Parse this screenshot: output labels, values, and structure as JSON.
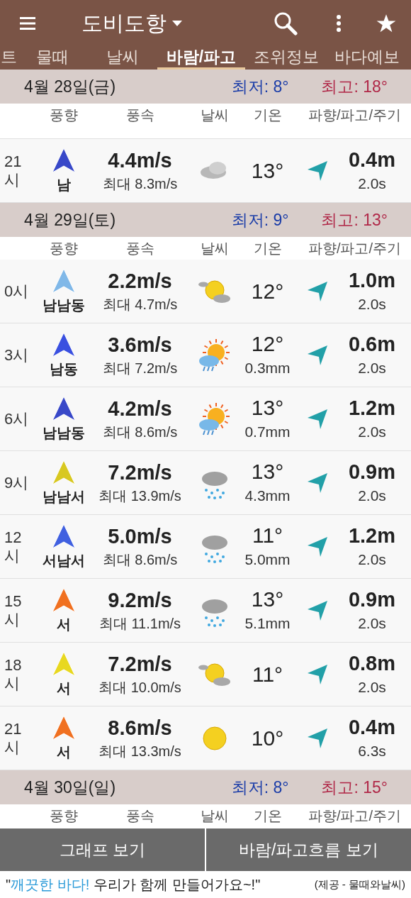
{
  "app_bar": {
    "title": "도비도항"
  },
  "tabs": [
    {
      "label": "트",
      "selected": false
    },
    {
      "label": "물때",
      "selected": false
    },
    {
      "label": "날씨",
      "selected": false
    },
    {
      "label": "바람/파고",
      "selected": true
    },
    {
      "label": "조위정보",
      "selected": false
    },
    {
      "label": "바다예보",
      "selected": false
    }
  ],
  "days": [
    {
      "date": "4월 28일(금)",
      "low": "최저: 8°",
      "high": "최고: 18°",
      "columns": [
        "풍향",
        "풍속",
        "날씨",
        "기온",
        "파향/파고/주기"
      ],
      "rows": [
        {
          "time": "21시",
          "direction": "남",
          "color": "#3848c8",
          "speed": "4.4m/s",
          "max": "최대 8.3m/s",
          "kind": "cloudy",
          "temp": "13°",
          "wave": "0.4m",
          "period": "2.0s"
        }
      ]
    },
    {
      "date": "4월 29일(토)",
      "low": "최저: 9°",
      "high": "최고: 13°",
      "columns": [
        "풍향",
        "풍속",
        "날씨",
        "기온",
        "파향/파고/주기"
      ],
      "rows": [
        {
          "time": "0시",
          "direction": "남남동",
          "color": "#80b8e8",
          "speed": "2.2m/s",
          "max": "최대 4.7m/s",
          "kind": "sun_cloud",
          "temp": "12°",
          "wave": "1.0m",
          "period": "2.0s"
        },
        {
          "time": "3시",
          "direction": "남동",
          "color": "#3a50e0",
          "speed": "3.6m/s",
          "max": "최대 7.2m/s",
          "kind": "sun_rain",
          "temp": "12°",
          "rain": "0.3mm",
          "wave": "0.6m",
          "period": "2.0s"
        },
        {
          "time": "6시",
          "direction": "남남동",
          "color": "#3848c8",
          "speed": "4.2m/s",
          "max": "최대 8.6m/s",
          "kind": "sun_rain",
          "temp": "13°",
          "rain": "0.7mm",
          "wave": "1.2m",
          "period": "2.0s"
        },
        {
          "time": "9시",
          "direction": "남남서",
          "color": "#d8c820",
          "speed": "7.2m/s",
          "max": "최대 13.9m/s",
          "kind": "rain",
          "temp": "13°",
          "rain": "4.3mm",
          "wave": "0.9m",
          "period": "2.0s"
        },
        {
          "time": "12시",
          "direction": "서남서",
          "color": "#4060e0",
          "speed": "5.0m/s",
          "max": "최대 8.6m/s",
          "kind": "rain",
          "temp": "11°",
          "rain": "5.0mm",
          "wave": "1.2m",
          "period": "2.0s"
        },
        {
          "time": "15시",
          "direction": "서",
          "color": "#f07020",
          "speed": "9.2m/s",
          "max": "최대 11.1m/s",
          "kind": "rain",
          "temp": "13°",
          "rain": "5.1mm",
          "wave": "0.9m",
          "period": "2.0s"
        },
        {
          "time": "18시",
          "direction": "서",
          "color": "#e8d820",
          "speed": "7.2m/s",
          "max": "최대 10.0m/s",
          "kind": "sun_cloud",
          "temp": "11°",
          "wave": "0.8m",
          "period": "2.0s"
        },
        {
          "time": "21시",
          "direction": "서",
          "color": "#f07020",
          "speed": "8.6m/s",
          "max": "최대 13.3m/s",
          "kind": "sun",
          "temp": "10°",
          "wave": "0.4m",
          "period": "6.3s"
        }
      ]
    },
    {
      "date": "4월 30일(일)",
      "low": "최저: 8°",
      "high": "최고: 15°",
      "columns": [
        "풍향",
        "풍속",
        "날씨",
        "기온",
        "파향/파고/주기"
      ]
    }
  ],
  "buttons": [
    "그래프 보기",
    "바람/파고흐름 보기"
  ],
  "footer": {
    "slogan": [
      {
        "text": "\"",
        "highlight": false
      },
      {
        "text": "깨끗한 바다!",
        "highlight": true
      },
      {
        "text": " 우리가 함께 만들어가요~!\"",
        "highlight": false
      }
    ],
    "credit": "(제공 - 물때와날씨)"
  }
}
